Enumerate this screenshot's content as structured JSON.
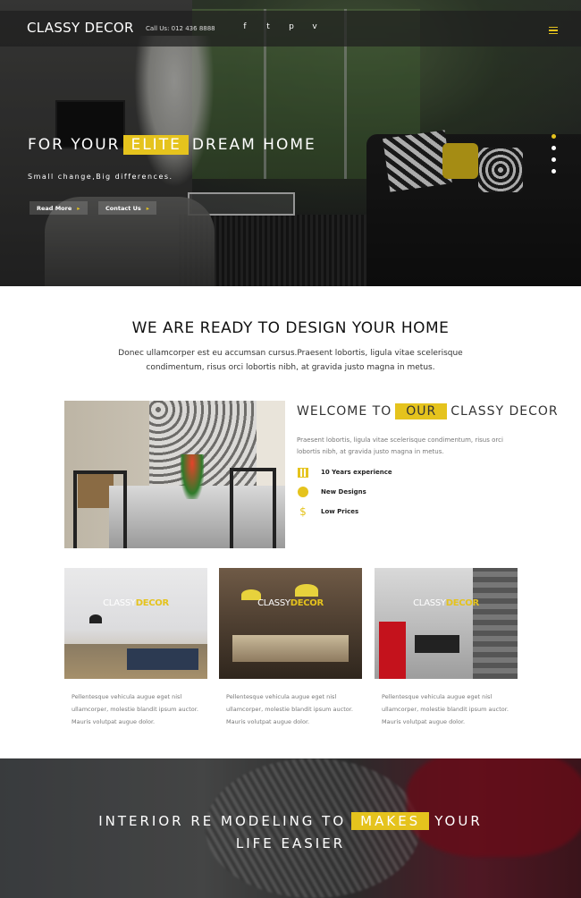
{
  "header": {
    "logo": "CLASSY DECOR",
    "call": "Call Us: 012 436 8888",
    "social": [
      "f",
      "t",
      "p",
      "v"
    ]
  },
  "hero": {
    "title_before": "FOR YOUR",
    "title_highlight": "ELITE",
    "title_after": "DREAM HOME",
    "subtitle": "Small change,Big differences.",
    "btn_read_more": "Read More",
    "btn_contact": "Contact Us",
    "slides": 4,
    "active_slide": 1
  },
  "intro": {
    "title": "WE ARE READY TO DESIGN YOUR HOME",
    "desc": "Donec ullamcorper est eu accumsan cursus.Praesent lobortis, ligula vitae scelerisque condimentum, risus orci lobortis nibh, at gravida justo magna in metus."
  },
  "welcome": {
    "before": "WELCOME TO",
    "highlight": "OUR",
    "after": "CLASSY DECOR",
    "text": "Praesent lobortis, ligula vitae scelerisque condimentum, risus orci lobortis nibh, at gravida justo magna in metus.",
    "features": [
      {
        "icon": "calendar-icon",
        "label": "10 Years experience"
      },
      {
        "icon": "circle-icon",
        "label": "New Designs"
      },
      {
        "icon": "dollar-icon",
        "label": "Low Prices"
      }
    ]
  },
  "cards": {
    "brand_a": "CLASSY",
    "brand_b": "DECOR",
    "items": [
      {
        "text": "Pellentesque vehicula augue eget nisl ullamcorper, molestie blandit ipsum auctor. Mauris volutpat augue dolor."
      },
      {
        "text": "Pellentesque vehicula augue eget nisl ullamcorper, molestie blandit ipsum auctor. Mauris volutpat augue dolor."
      },
      {
        "text": "Pellentesque vehicula augue eget nisl ullamcorper, molestie blandit ipsum auctor. Mauris volutpat augue dolor."
      }
    ]
  },
  "banner": {
    "line1_before": "INTERIOR RE MODELING TO",
    "line1_highlight": "MAKES",
    "line1_after": "YOUR",
    "line2": "LIFE EASIER"
  },
  "colors": {
    "accent": "#e5c31d",
    "dark": "#1e1e1e"
  }
}
